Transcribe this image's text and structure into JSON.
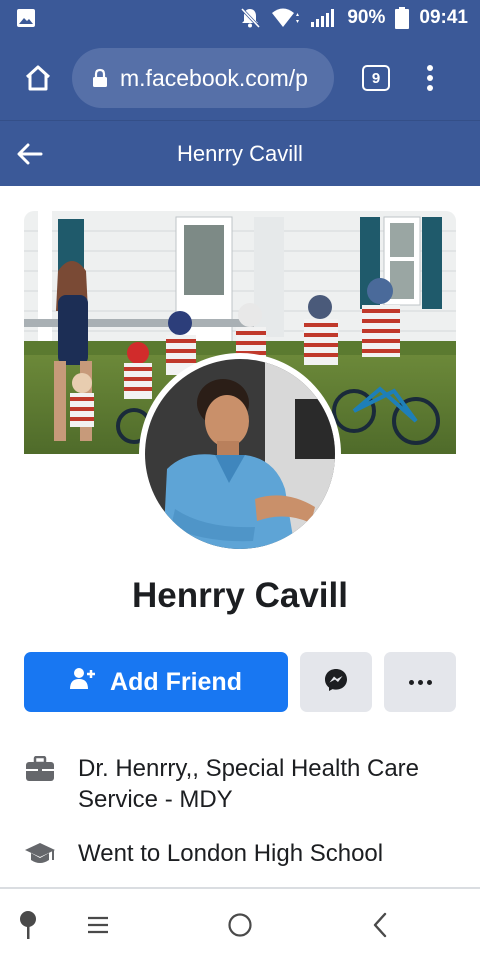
{
  "status_bar": {
    "battery_percent": "90%",
    "time": "09:41",
    "icons": [
      "image-icon",
      "mute-icon",
      "wifi-icon",
      "signal-icon",
      "battery-icon"
    ]
  },
  "browser": {
    "url": "m.facebook.com/p",
    "tab_count": "9",
    "icons": [
      "home-icon",
      "lock-icon",
      "overflow-menu-icon"
    ]
  },
  "header": {
    "title": "Henrry Cavill",
    "back_icon": "back-arrow-icon"
  },
  "profile": {
    "name": "Henrry Cavill",
    "cover_photo": "family-cover-photo",
    "profile_photo": "profile-photo"
  },
  "actions": {
    "add_friend_label": "Add Friend",
    "add_friend_icon": "add-person-icon",
    "messenger_icon": "messenger-icon",
    "more_icon": "more-icon",
    "accent_color": "#1877f2"
  },
  "info": {
    "work": "Dr. Henrry,, Special Health Care Service - MDY",
    "work_icon": "briefcase-icon",
    "education": "Went to London High School",
    "education_icon": "graduation-cap-icon"
  },
  "nav_bar": {
    "icons": [
      "pin-icon",
      "recents-icon",
      "home-circle-icon",
      "back-chevron-icon"
    ]
  },
  "colors": {
    "brand": "#3b5998",
    "text": "#1c1e21",
    "secondary_button": "#e4e6eb"
  }
}
